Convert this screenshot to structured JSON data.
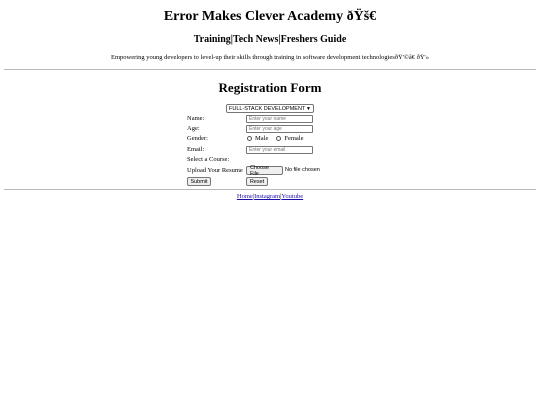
{
  "header": {
    "title": "Error Makes Clever Academy ðŸš€",
    "nav": [
      "Training",
      "Tech News",
      "Freshers Guide"
    ],
    "nav_separator": "|",
    "tagline": "Empowering young developers to level-up their skills through training in software development technologiesðŸ'©â€     ðŸ'»"
  },
  "form": {
    "title": "Registration Form",
    "course_selected": "FULL-STACK DEVELOPMENT",
    "name_label": "Name:",
    "name_placeholder": "Enter your name",
    "age_label": "Age:",
    "age_placeholder": "Enter your age",
    "gender_label": "Gender:",
    "gender_options": [
      "Male",
      "Female"
    ],
    "email_label": "Email:",
    "email_placeholder": "Enter your email",
    "course_label": "Select a Course:",
    "resume_label": "Upload Your Resume",
    "choose_file_label": "Choose File",
    "file_status": "No file chosen",
    "submit_label": "Submit",
    "reset_label": "Reset"
  },
  "footer": {
    "links": [
      "Home",
      "Instagram",
      "Youtube"
    ],
    "separator": "|"
  }
}
